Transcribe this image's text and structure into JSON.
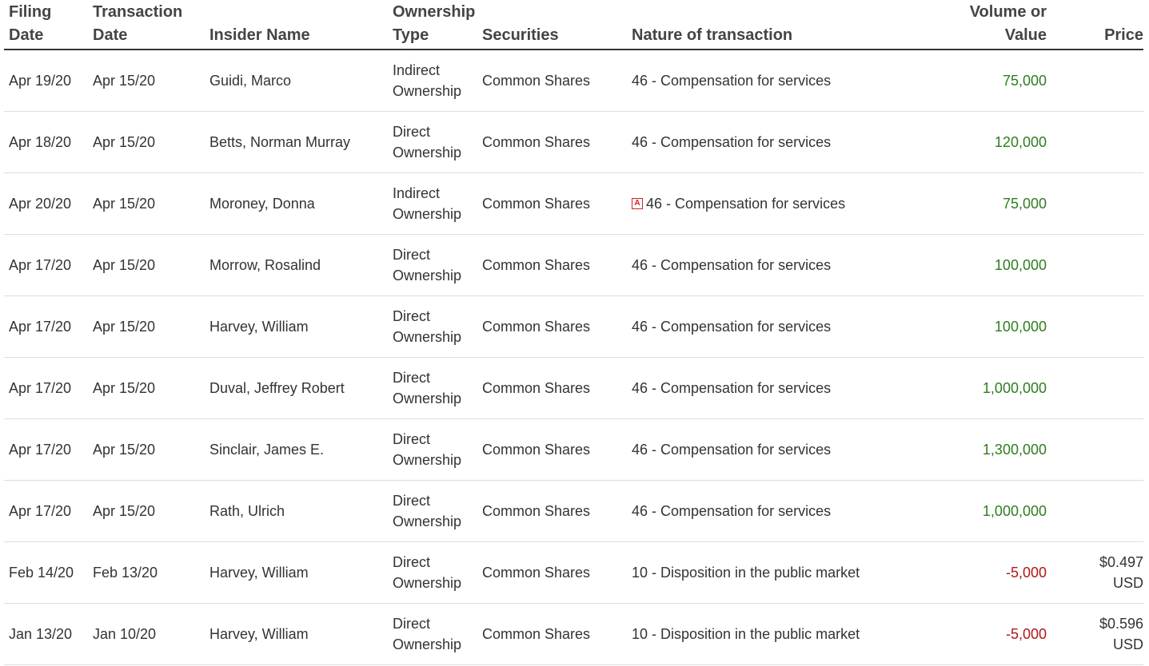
{
  "columns": {
    "filing_date": "Filing Date",
    "transaction_date": "Transaction Date",
    "insider_name": "Insider Name",
    "ownership_type": "Ownership Type",
    "securities": "Securities",
    "nature": "Nature of transaction",
    "volume": "Volume or Value",
    "price": "Price"
  },
  "rows": [
    {
      "filing": "Apr 19/20",
      "trans": "Apr 15/20",
      "name": "Guidi, Marco",
      "own1": "Indirect",
      "own2": "Ownership",
      "sec": "Common Shares",
      "nature": "46 - Compensation for services",
      "volume": "75,000",
      "price1": "",
      "price2": ""
    },
    {
      "filing": "Apr 18/20",
      "trans": "Apr 15/20",
      "name": "Betts, Norman Murray",
      "own1": "Direct",
      "own2": "Ownership",
      "sec": "Common Shares",
      "nature": "46 - Compensation for services",
      "volume": "120,000",
      "price1": "",
      "price2": ""
    },
    {
      "filing": "Apr 20/20",
      "trans": "Apr 15/20",
      "name": "Moroney, Donna",
      "own1": "Indirect",
      "own2": "Ownership",
      "sec": "Common Shares",
      "nature": "46 - Compensation for services",
      "volume": "75,000",
      "price1": "",
      "price2": "",
      "icon": "A"
    },
    {
      "filing": "Apr 17/20",
      "trans": "Apr 15/20",
      "name": "Morrow, Rosalind",
      "own1": "Direct",
      "own2": "Ownership",
      "sec": "Common Shares",
      "nature": "46 - Compensation for services",
      "volume": "100,000",
      "price1": "",
      "price2": ""
    },
    {
      "filing": "Apr 17/20",
      "trans": "Apr 15/20",
      "name": "Harvey, William",
      "own1": "Direct",
      "own2": "Ownership",
      "sec": "Common Shares",
      "nature": "46 - Compensation for services",
      "volume": "100,000",
      "price1": "",
      "price2": ""
    },
    {
      "filing": "Apr 17/20",
      "trans": "Apr 15/20",
      "name": "Duval, Jeffrey Robert",
      "own1": "Direct",
      "own2": "Ownership",
      "sec": "Common Shares",
      "nature": "46 - Compensation for services",
      "volume": "1,000,000",
      "price1": "",
      "price2": ""
    },
    {
      "filing": "Apr 17/20",
      "trans": "Apr 15/20",
      "name": "Sinclair, James E.",
      "own1": "Direct",
      "own2": "Ownership",
      "sec": "Common Shares",
      "nature": "46 - Compensation for services",
      "volume": "1,300,000",
      "price1": "",
      "price2": ""
    },
    {
      "filing": "Apr 17/20",
      "trans": "Apr 15/20",
      "name": "Rath, Ulrich",
      "own1": "Direct",
      "own2": "Ownership",
      "sec": "Common Shares",
      "nature": "46 - Compensation for services",
      "volume": "1,000,000",
      "price1": "",
      "price2": ""
    },
    {
      "filing": "Feb 14/20",
      "trans": "Feb 13/20",
      "name": "Harvey, William",
      "own1": "Direct",
      "own2": "Ownership",
      "sec": "Common Shares",
      "nature": "10 - Disposition in the public market",
      "volume": "-5,000",
      "price1": "$0.497",
      "price2": "USD"
    },
    {
      "filing": "Jan 13/20",
      "trans": "Jan 10/20",
      "name": "Harvey, William",
      "own1": "Direct",
      "own2": "Ownership",
      "sec": "Common Shares",
      "nature": "10 - Disposition in the public market",
      "volume": "-5,000",
      "price1": "$0.596",
      "price2": "USD"
    }
  ],
  "colors": {
    "positive": "#2e7d1f",
    "negative": "#b01818",
    "icon": "#cc2222"
  },
  "icons": {
    "document": "pdf-document-icon"
  }
}
